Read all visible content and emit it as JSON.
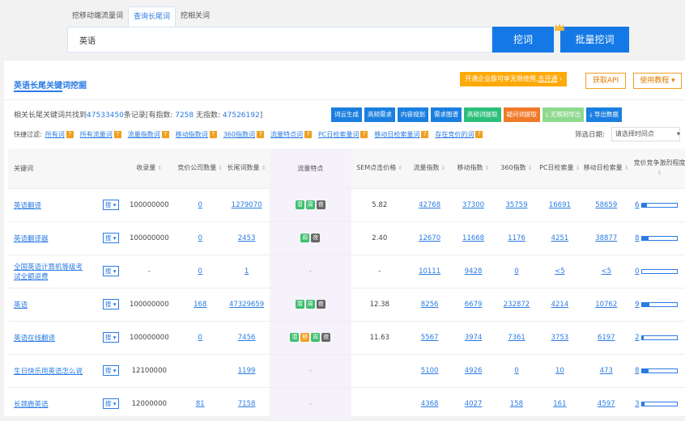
{
  "tabs": [
    {
      "label": "挖移动端流量词",
      "active": false
    },
    {
      "label": "查询长尾词",
      "active": true
    },
    {
      "label": "挖相关词",
      "active": false
    }
  ],
  "search": {
    "value": "英语"
  },
  "buttons": {
    "dig": "挖词",
    "batch": "批量挖词"
  },
  "panel": {
    "title": "英语长尾关键词挖掘",
    "promo_text": "开通企业版可享无限使用,",
    "promo_link": "去开通",
    "promo_arrow": "›",
    "api": "获取API",
    "tutorial": "使用教程 ▾"
  },
  "summary": {
    "prefix": "相关长尾关键词共找到",
    "total": "47533450",
    "mid": "条记录[有指数: ",
    "with_index": "7258",
    "mid2": " 无指数: ",
    "no_index": "47526192",
    "suffix": "]"
  },
  "actions": [
    {
      "label": "词云生成",
      "color": "#1a7fe0"
    },
    {
      "label": "高频需求",
      "color": "#1a7fe0"
    },
    {
      "label": "内容规划",
      "color": "#1a7fe0"
    },
    {
      "label": "需求图谱",
      "color": "#1a7fe0"
    },
    {
      "label": "高频词提取",
      "color": "#2cbf79"
    },
    {
      "label": "疑问词提取",
      "color": "#f07a28"
    },
    {
      "label": "⤓ 无限制导出",
      "color": "#8fd98f"
    },
    {
      "label": "⤓ 导出数据",
      "color": "#1a7fe0"
    }
  ],
  "filter": {
    "label": "快捷过滤:",
    "items": [
      "所有词",
      "所有流量词",
      "流量指数词",
      "移动指数词",
      "360指数词",
      "流量特点词",
      "PC日检索量词",
      "移动日检索量词",
      "存在竞价的词"
    ],
    "date_label": "筛选日期:",
    "date_placeholder": "请选择时间点"
  },
  "columns": [
    "关键词",
    "收录量",
    "竞价公司数量",
    "长尾词数量",
    "流量特点",
    "SEM点击价格",
    "流量指数",
    "移动指数",
    "360指数",
    "PC日检索量",
    "移动日检索量",
    "竞价竞争激烈程度"
  ],
  "rows": [
    {
      "kw": "英语翻译",
      "sou": "搜 ▾",
      "shoulu": "100000000",
      "company": "0",
      "longtail": "1279070",
      "feat": [
        "潜",
        "周",
        "夜"
      ],
      "sem": "5.82",
      "flow": "42768",
      "mobile": "37300",
      "idx360": "35759",
      "pc": "16691",
      "mday": "58659",
      "comp": "6",
      "comp_level": 0.15
    },
    {
      "kw": "英语翻译器",
      "sou": "搜 ▾",
      "shoulu": "100000000",
      "company": "0",
      "longtail": "2453",
      "feat": [
        "周",
        "夜"
      ],
      "sem": "2.40",
      "flow": "12670",
      "mobile": "11668",
      "idx360": "1176",
      "pc": "4251",
      "mday": "38877",
      "comp": "8",
      "comp_level": 0.2
    },
    {
      "kw": "全国英语计算机等级考试全额退费",
      "sou": "搜 ▾",
      "shoulu": "-",
      "company": "0",
      "longtail": "1",
      "feat": [],
      "sem": "-",
      "flow": "10111",
      "mobile": "9428",
      "idx360": "0",
      "pc": "<5",
      "mday": "<5",
      "comp": "0",
      "comp_level": 0
    },
    {
      "kw": "英语",
      "sou": "搜 ▾",
      "shoulu": "100000000",
      "company": "168",
      "longtail": "47329659",
      "feat": [
        "潜",
        "周",
        "夜"
      ],
      "sem": "12.38",
      "flow": "8256",
      "mobile": "6679",
      "idx360": "232872",
      "pc": "4214",
      "mday": "10762",
      "comp": "9",
      "comp_level": 0.22
    },
    {
      "kw": "英语在线翻译",
      "sou": "搜 ▾",
      "shoulu": "100000000",
      "company": "0",
      "longtail": "7456",
      "feat": [
        "潜",
        "移",
        "周",
        "夜"
      ],
      "sem": "11.63",
      "flow": "5567",
      "mobile": "3974",
      "idx360": "7361",
      "pc": "3753",
      "mday": "6197",
      "comp": "2",
      "comp_level": 0.05
    },
    {
      "kw": "生日快乐用英语怎么说",
      "sou": "搜 ▾",
      "shoulu": "12100000",
      "company": "",
      "longtail": "1199",
      "feat": [],
      "sem": "",
      "flow": "5100",
      "mobile": "4926",
      "idx360": "0",
      "pc": "10",
      "mday": "473",
      "comp": "8",
      "comp_level": 0.2
    },
    {
      "kw": "长颈鹿英语",
      "sou": "搜 ▾",
      "shoulu": "12000000",
      "company": "81",
      "longtail": "7158",
      "feat": [],
      "sem": "",
      "flow": "4368",
      "mobile": "4027",
      "idx360": "158",
      "pc": "161",
      "mday": "4597",
      "comp": "3",
      "comp_level": 0.08
    }
  ],
  "feat_colors": {
    "潜": "#3fbf6f",
    "移": "#f0a020",
    "周": "#3fbf6f",
    "夜": "#666666"
  }
}
